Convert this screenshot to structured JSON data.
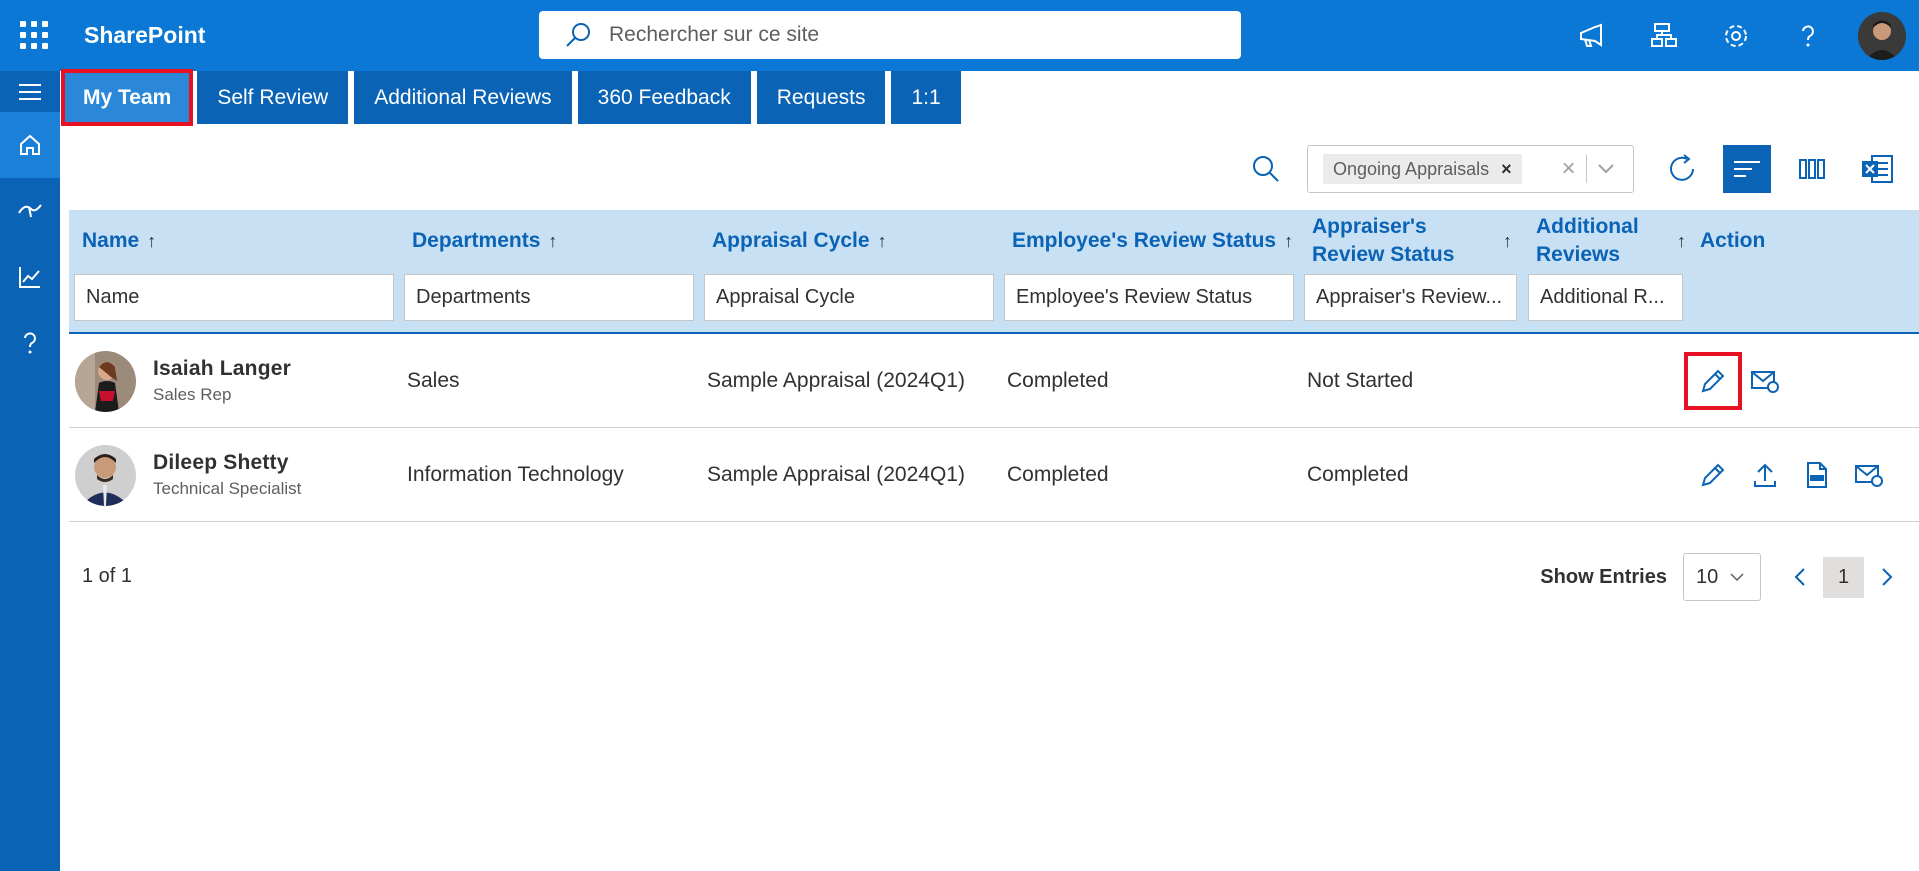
{
  "app": {
    "brand": "SharePoint"
  },
  "search": {
    "placeholder": "Rechercher sur ce site"
  },
  "tabs": [
    {
      "label": "My Team",
      "active": true
    },
    {
      "label": "Self Review"
    },
    {
      "label": "Additional Reviews"
    },
    {
      "label": "360 Feedback"
    },
    {
      "label": "Requests"
    },
    {
      "label": "1:1"
    }
  ],
  "toolbar": {
    "filter_chip": "Ongoing Appraisals",
    "chip_remove": "×",
    "clear": "×"
  },
  "table": {
    "columns": [
      {
        "label": "Name",
        "arrow": "↑",
        "filter": "Name"
      },
      {
        "label": "Departments",
        "arrow": "↑",
        "filter": "Departments"
      },
      {
        "label": "Appraisal Cycle",
        "arrow": "↑",
        "filter": "Appraisal Cycle"
      },
      {
        "label": "Employee's Review Status",
        "arrow": "↑",
        "filter": "Employee's Review Status"
      },
      {
        "label_line1": "Appraiser's",
        "label_line2": "Review Status",
        "arrow": "↑",
        "filter": "Appraiser's Review..."
      },
      {
        "label_line1": "Additional",
        "label_line2": "Reviews",
        "arrow": "↑",
        "filter": "Additional R..."
      },
      {
        "label": "Action"
      }
    ],
    "rows": [
      {
        "name": "Isaiah Langer",
        "role": "Sales Rep",
        "department": "Sales",
        "cycle": "Sample Appraisal (2024Q1)",
        "employee_status": "Completed",
        "appraiser_status": "Not Started",
        "additional": ""
      },
      {
        "name": "Dileep Shetty",
        "role": "Technical Specialist",
        "department": "Information Technology",
        "cycle": "Sample Appraisal (2024Q1)",
        "employee_status": "Completed",
        "appraiser_status": "Completed",
        "additional": ""
      }
    ]
  },
  "footer": {
    "count": "1 of 1",
    "show_entries_label": "Show Entries",
    "entries_value": "10",
    "current_page": "1"
  },
  "colors": {
    "suitebar": "#0a78d4",
    "nav": "#0a63b4",
    "header_bg": "#c7e0f4",
    "highlight": "#e81123"
  }
}
